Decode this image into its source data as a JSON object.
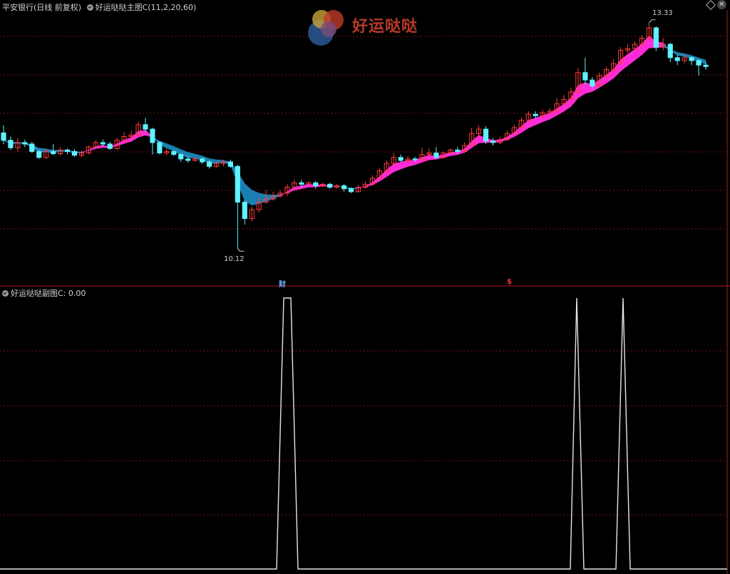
{
  "header": {
    "stock_title": "平安银行(日线 前复权)",
    "main_indicator": "好运哒哒主图C(11,2,20,60)",
    "sub_indicator": "好运哒哒副图C",
    "sub_value": ": 0.00",
    "logo_text": "好运哒哒"
  },
  "annotations": {
    "high_label": "13.33",
    "low_label": "10.12",
    "marker_cai": "财",
    "marker_dollar": "$"
  },
  "colors": {
    "up_candle": "#ff3b3b",
    "down_candle": "#5ff2ff",
    "ribbon_up": "#ff2bd6",
    "ribbon_down": "#1a7fb0",
    "grid": "#7a1010",
    "signal_line": "#e6e6e6"
  },
  "chart_data": [
    {
      "type": "candlestick",
      "title": "好运哒哒主图C(11,2,20,60)",
      "ylim": [
        9.9,
        13.5
      ],
      "candles": [
        [
          11.85,
          11.75,
          11.95,
          11.7
        ],
        [
          11.75,
          11.65,
          11.8,
          11.62
        ],
        [
          11.65,
          11.72,
          11.78,
          11.6
        ],
        [
          11.72,
          11.7,
          11.76,
          11.66
        ],
        [
          11.7,
          11.6,
          11.73,
          11.58
        ],
        [
          11.6,
          11.52,
          11.62,
          11.5
        ],
        [
          11.52,
          11.6,
          11.64,
          11.5
        ],
        [
          11.6,
          11.57,
          11.7,
          11.55
        ],
        [
          11.57,
          11.62,
          11.66,
          11.55
        ],
        [
          11.62,
          11.6,
          11.64,
          11.56
        ],
        [
          11.6,
          11.55,
          11.63,
          11.53
        ],
        [
          11.55,
          11.58,
          11.61,
          11.52
        ],
        [
          11.58,
          11.66,
          11.68,
          11.56
        ],
        [
          11.66,
          11.72,
          11.75,
          11.64
        ],
        [
          11.72,
          11.7,
          11.76,
          11.67
        ],
        [
          11.7,
          11.64,
          11.73,
          11.62
        ],
        [
          11.64,
          11.75,
          11.78,
          11.62
        ],
        [
          11.75,
          11.8,
          11.86,
          11.72
        ],
        [
          11.8,
          11.82,
          11.88,
          11.76
        ],
        [
          11.82,
          11.96,
          12.0,
          11.8
        ],
        [
          11.96,
          11.9,
          12.05,
          11.86
        ],
        [
          11.9,
          11.72,
          11.92,
          11.56
        ],
        [
          11.72,
          11.58,
          11.74,
          11.56
        ],
        [
          11.58,
          11.6,
          11.64,
          11.55
        ],
        [
          11.6,
          11.56,
          11.62,
          11.54
        ],
        [
          11.56,
          11.5,
          11.58,
          11.46
        ],
        [
          11.5,
          11.48,
          11.54,
          11.45
        ],
        [
          11.48,
          11.5,
          11.53,
          11.46
        ],
        [
          11.5,
          11.46,
          11.52,
          11.43
        ],
        [
          11.46,
          11.4,
          11.48,
          11.37
        ],
        [
          11.4,
          11.44,
          11.47,
          11.38
        ],
        [
          11.44,
          11.46,
          11.49,
          11.4
        ],
        [
          11.46,
          11.4,
          11.49,
          11.38
        ],
        [
          11.4,
          10.92,
          11.42,
          10.3
        ],
        [
          10.92,
          10.7,
          10.95,
          10.62
        ],
        [
          10.7,
          10.82,
          10.86,
          10.66
        ],
        [
          10.82,
          10.92,
          10.98,
          10.78
        ],
        [
          10.92,
          10.96,
          11.08,
          10.9
        ],
        [
          10.96,
          11.0,
          11.06,
          10.94
        ],
        [
          11.0,
          11.04,
          11.08,
          10.98
        ],
        [
          11.04,
          11.12,
          11.16,
          11.0
        ],
        [
          11.12,
          11.18,
          11.22,
          11.08
        ],
        [
          11.18,
          11.16,
          11.22,
          11.12
        ],
        [
          11.16,
          11.18,
          11.2,
          11.14
        ],
        [
          11.18,
          11.14,
          11.2,
          11.1
        ],
        [
          11.14,
          11.16,
          11.18,
          11.12
        ],
        [
          11.16,
          11.12,
          11.18,
          11.1
        ],
        [
          11.12,
          11.14,
          11.16,
          11.1
        ],
        [
          11.14,
          11.1,
          11.16,
          11.06
        ],
        [
          11.1,
          11.06,
          11.12,
          11.04
        ],
        [
          11.06,
          11.12,
          11.15,
          11.05
        ],
        [
          11.12,
          11.16,
          11.2,
          11.1
        ],
        [
          11.16,
          11.24,
          11.28,
          11.14
        ],
        [
          11.24,
          11.34,
          11.38,
          11.22
        ],
        [
          11.34,
          11.44,
          11.48,
          11.3
        ],
        [
          11.44,
          11.52,
          11.58,
          11.42
        ],
        [
          11.52,
          11.48,
          11.56,
          11.46
        ],
        [
          11.48,
          11.5,
          11.54,
          11.44
        ],
        [
          11.5,
          11.49,
          11.53,
          11.46
        ],
        [
          11.49,
          11.56,
          11.65,
          11.47
        ],
        [
          11.56,
          11.58,
          11.64,
          11.54
        ],
        [
          11.58,
          11.52,
          11.66,
          11.5
        ],
        [
          11.52,
          11.58,
          11.6,
          11.5
        ],
        [
          11.58,
          11.62,
          11.64,
          11.56
        ],
        [
          11.62,
          11.6,
          11.66,
          11.57
        ],
        [
          11.6,
          11.68,
          11.72,
          11.58
        ],
        [
          11.68,
          11.84,
          11.92,
          11.66
        ],
        [
          11.84,
          11.9,
          11.95,
          11.8
        ],
        [
          11.9,
          11.74,
          11.94,
          11.7
        ],
        [
          11.74,
          11.72,
          11.78,
          11.68
        ],
        [
          11.72,
          11.76,
          11.8,
          11.7
        ],
        [
          11.76,
          11.84,
          11.88,
          11.74
        ],
        [
          11.84,
          11.92,
          11.96,
          11.82
        ],
        [
          11.92,
          12.02,
          12.06,
          11.9
        ],
        [
          12.02,
          12.1,
          12.14,
          12.0
        ],
        [
          12.1,
          12.08,
          12.14,
          12.04
        ],
        [
          12.08,
          12.12,
          12.16,
          12.04
        ],
        [
          12.12,
          12.14,
          12.18,
          12.08
        ],
        [
          12.14,
          12.24,
          12.32,
          12.12
        ],
        [
          12.24,
          12.3,
          12.36,
          12.2
        ],
        [
          12.3,
          12.4,
          12.46,
          12.28
        ],
        [
          12.4,
          12.66,
          12.72,
          12.38
        ],
        [
          12.66,
          12.56,
          12.86,
          12.5
        ],
        [
          12.56,
          12.48,
          12.6,
          12.44
        ],
        [
          12.48,
          12.62,
          12.66,
          12.46
        ],
        [
          12.62,
          12.7,
          12.74,
          12.58
        ],
        [
          12.7,
          12.78,
          12.84,
          12.66
        ],
        [
          12.78,
          12.96,
          13.0,
          12.76
        ],
        [
          12.96,
          12.98,
          13.04,
          12.92
        ],
        [
          12.98,
          13.04,
          13.08,
          12.94
        ],
        [
          13.04,
          13.12,
          13.16,
          13.0
        ],
        [
          13.12,
          13.26,
          13.33,
          13.08
        ],
        [
          13.26,
          13.0,
          13.28,
          12.95
        ],
        [
          13.0,
          13.04,
          13.12,
          12.96
        ],
        [
          13.04,
          12.86,
          13.06,
          12.8
        ],
        [
          12.86,
          12.82,
          12.9,
          12.76
        ],
        [
          12.82,
          12.86,
          12.92,
          12.78
        ],
        [
          12.86,
          12.82,
          12.88,
          12.76
        ],
        [
          12.82,
          12.76,
          12.84,
          12.62
        ],
        [
          12.76,
          12.74,
          12.8,
          12.7
        ]
      ],
      "high": 13.33,
      "low": 10.12
    },
    {
      "type": "line",
      "title": "好运哒哒副图C",
      "ylim": [
        0,
        1
      ],
      "series": [
        {
          "x": [
            0,
            388,
            398,
            408,
            418,
            800,
            809,
            819,
            864,
            874,
            884,
            1020
          ],
          "values": [
            0,
            0,
            1,
            1,
            0,
            0,
            1,
            0,
            0,
            1,
            0,
            0
          ]
        }
      ]
    }
  ]
}
